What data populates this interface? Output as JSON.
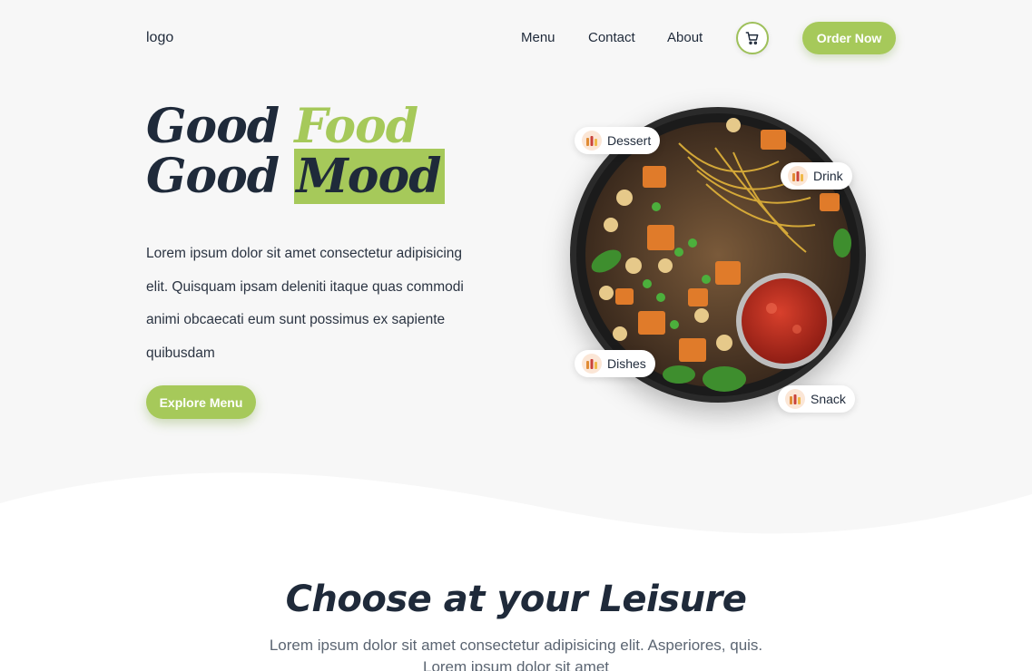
{
  "nav": {
    "logo": "logo",
    "links": [
      "Menu",
      "Contact",
      "About"
    ],
    "cart_icon": "cart-icon",
    "order_label": "Order Now"
  },
  "hero": {
    "line1_a": "Good ",
    "line1_b": "Food",
    "line2_a": "Good ",
    "line2_b": "Mood",
    "text": "Lorem ipsum dolor sit amet consectetur adipisicing elit. Quisquam ipsam deleniti itaque quas commodi animi obcaecati eum sunt possimus ex sapiente quibusdam",
    "explore_label": "Explore Menu"
  },
  "categories": [
    "Dessert",
    "Drink",
    "Dishes",
    "Snack"
  ],
  "section": {
    "title": "Choose at your Leisure",
    "subtitle": "Lorem ipsum dolor sit amet consectetur adipisicing elit. Asperiores, quis. Lorem ipsum dolor sit amet"
  },
  "colors": {
    "accent": "#a6c95a",
    "text": "#1f2a3a",
    "background": "#f7f7f7"
  }
}
